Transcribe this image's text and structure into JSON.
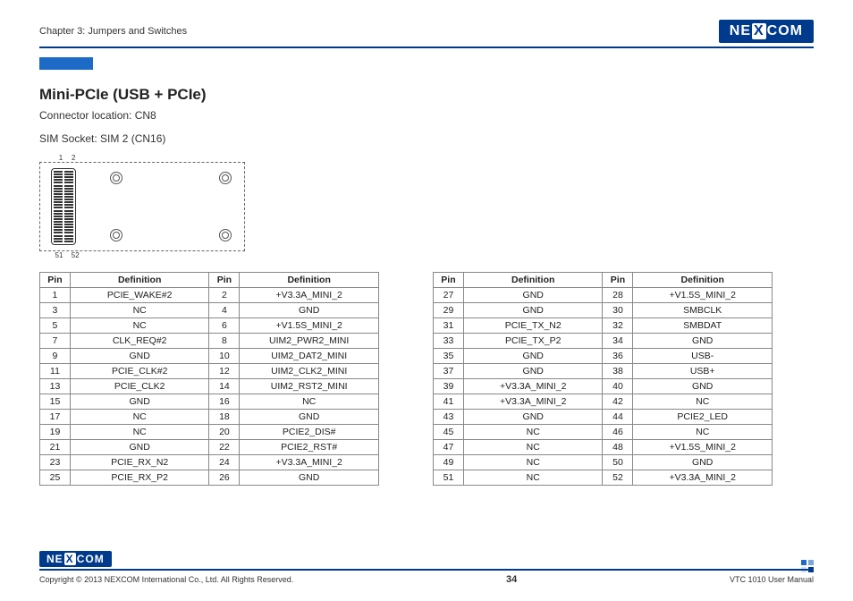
{
  "header": {
    "chapter": "Chapter 3: Jumpers and Switches",
    "logo_text_a": "NE",
    "logo_text_x": "X",
    "logo_text_b": "COM"
  },
  "section": {
    "title": "Mini-PCIe (USB + PCIe)",
    "line1": "Connector location: CN8",
    "line2": "SIM Socket: SIM 2 (CN16)"
  },
  "diagram_labels": {
    "top_left": "1",
    "top_right": "2",
    "bot_left": "51",
    "bot_right": "52"
  },
  "table_headers": {
    "pin": "Pin",
    "def": "Definition"
  },
  "table1": [
    {
      "p1": "1",
      "d1": "PCIE_WAKE#2",
      "p2": "2",
      "d2": "+V3.3A_MINI_2"
    },
    {
      "p1": "3",
      "d1": "NC",
      "p2": "4",
      "d2": "GND"
    },
    {
      "p1": "5",
      "d1": "NC",
      "p2": "6",
      "d2": "+V1.5S_MINI_2"
    },
    {
      "p1": "7",
      "d1": "CLK_REQ#2",
      "p2": "8",
      "d2": "UIM2_PWR2_MINI"
    },
    {
      "p1": "9",
      "d1": "GND",
      "p2": "10",
      "d2": "UIM2_DAT2_MINI"
    },
    {
      "p1": "11",
      "d1": "PCIE_CLK#2",
      "p2": "12",
      "d2": "UIM2_CLK2_MINI"
    },
    {
      "p1": "13",
      "d1": "PCIE_CLK2",
      "p2": "14",
      "d2": "UIM2_RST2_MINI"
    },
    {
      "p1": "15",
      "d1": "GND",
      "p2": "16",
      "d2": "NC"
    },
    {
      "p1": "17",
      "d1": "NC",
      "p2": "18",
      "d2": "GND"
    },
    {
      "p1": "19",
      "d1": "NC",
      "p2": "20",
      "d2": "PCIE2_DIS#"
    },
    {
      "p1": "21",
      "d1": "GND",
      "p2": "22",
      "d2": "PCIE2_RST#"
    },
    {
      "p1": "23",
      "d1": "PCIE_RX_N2",
      "p2": "24",
      "d2": "+V3.3A_MINI_2"
    },
    {
      "p1": "25",
      "d1": "PCIE_RX_P2",
      "p2": "26",
      "d2": "GND"
    }
  ],
  "table2": [
    {
      "p1": "27",
      "d1": "GND",
      "p2": "28",
      "d2": "+V1.5S_MINI_2"
    },
    {
      "p1": "29",
      "d1": "GND",
      "p2": "30",
      "d2": "SMBCLK"
    },
    {
      "p1": "31",
      "d1": "PCIE_TX_N2",
      "p2": "32",
      "d2": "SMBDAT"
    },
    {
      "p1": "33",
      "d1": "PCIE_TX_P2",
      "p2": "34",
      "d2": "GND"
    },
    {
      "p1": "35",
      "d1": "GND",
      "p2": "36",
      "d2": "USB-"
    },
    {
      "p1": "37",
      "d1": "GND",
      "p2": "38",
      "d2": "USB+"
    },
    {
      "p1": "39",
      "d1": "+V3.3A_MINI_2",
      "p2": "40",
      "d2": "GND"
    },
    {
      "p1": "41",
      "d1": "+V3.3A_MINI_2",
      "p2": "42",
      "d2": "NC"
    },
    {
      "p1": "43",
      "d1": "GND",
      "p2": "44",
      "d2": "PCIE2_LED"
    },
    {
      "p1": "45",
      "d1": "NC",
      "p2": "46",
      "d2": "NC"
    },
    {
      "p1": "47",
      "d1": "NC",
      "p2": "48",
      "d2": "+V1.5S_MINI_2"
    },
    {
      "p1": "49",
      "d1": "NC",
      "p2": "50",
      "d2": "GND"
    },
    {
      "p1": "51",
      "d1": "NC",
      "p2": "52",
      "d2": "+V3.3A_MINI_2"
    }
  ],
  "footer": {
    "copyright": "Copyright © 2013 NEXCOM International Co., Ltd. All Rights Reserved.",
    "page": "34",
    "manual": "VTC 1010 User Manual"
  }
}
